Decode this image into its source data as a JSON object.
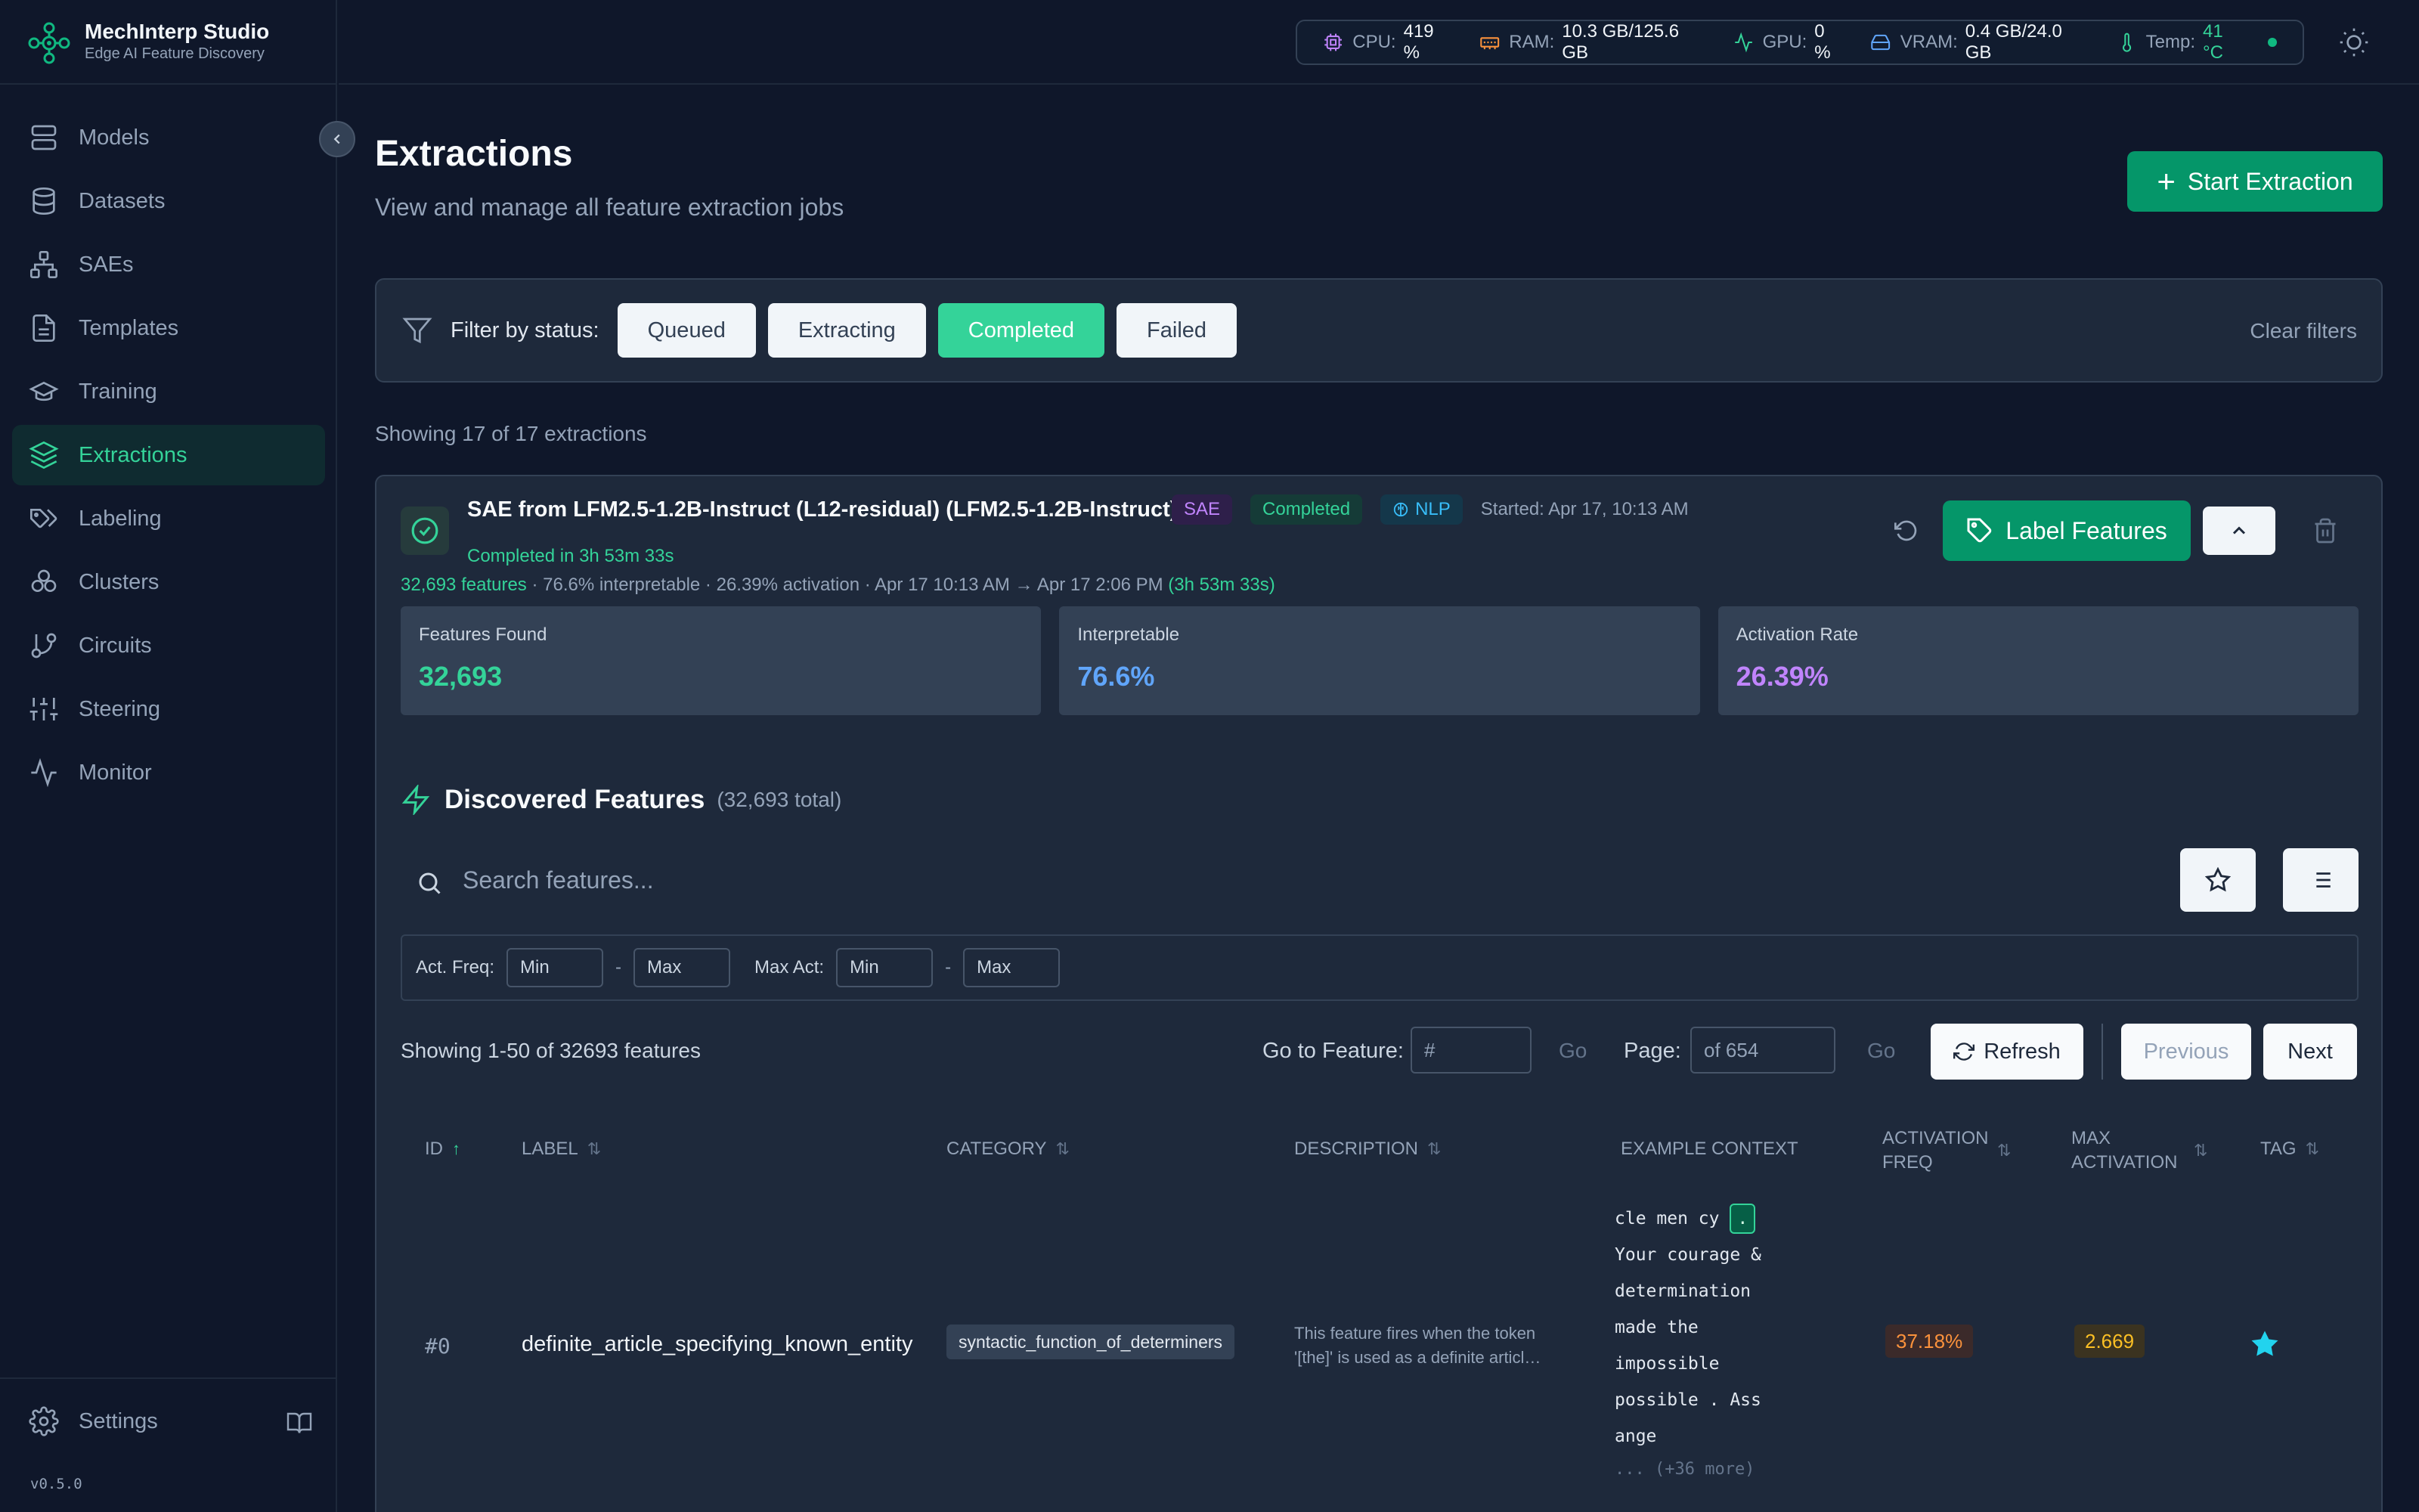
{
  "app": {
    "title": "MechInterp Studio",
    "subtitle": "Edge AI Feature Discovery",
    "version": "v0.5.0"
  },
  "sidebar": {
    "items": [
      {
        "label": "Models",
        "icon": "server-icon"
      },
      {
        "label": "Datasets",
        "icon": "database-icon"
      },
      {
        "label": "SAEs",
        "icon": "network-icon"
      },
      {
        "label": "Templates",
        "icon": "file-text-icon"
      },
      {
        "label": "Training",
        "icon": "graduation-cap-icon"
      },
      {
        "label": "Extractions",
        "icon": "layers-icon",
        "active": true
      },
      {
        "label": "Labeling",
        "icon": "tags-icon"
      },
      {
        "label": "Clusters",
        "icon": "clusters-icon"
      },
      {
        "label": "Circuits",
        "icon": "git-branch-icon"
      },
      {
        "label": "Steering",
        "icon": "sliders-icon"
      },
      {
        "label": "Monitor",
        "icon": "activity-icon"
      }
    ],
    "settings_label": "Settings"
  },
  "system": {
    "cpu_label": "CPU:",
    "cpu": "419 %",
    "ram_label": "RAM:",
    "ram": "10.3 GB/125.6 GB",
    "gpu_label": "GPU:",
    "gpu": "0 %",
    "vram_label": "VRAM:",
    "vram": "0.4 GB/24.0 GB",
    "temp_label": "Temp:",
    "temp": "41 °C",
    "colors": {
      "cpu": "#c084fc",
      "ram": "#fb923c",
      "gpu": "#34d399",
      "vram": "#60a5fa",
      "temp": "#34d399"
    }
  },
  "page": {
    "title": "Extractions",
    "subtitle": "View and manage all feature extraction jobs",
    "start_button": "Start Extraction",
    "filter_label": "Filter by status:",
    "filters": [
      "Queued",
      "Extracting",
      "Completed",
      "Failed"
    ],
    "active_filter": "Completed",
    "clear_filters": "Clear filters",
    "showing": "Showing 17 of 17 extractions"
  },
  "job": {
    "title": "SAE from LFM2.5-1.2B-Instruct (L12-residual) (LFM2.5-1.2B-Instruct)",
    "badge_type": "SAE",
    "badge_status": "Completed",
    "badge_domain": "NLP",
    "started": "Started: Apr 17, 10:13 AM",
    "completed_in": "Completed in 3h 53m 33s",
    "summary_features": "32,693 features",
    "summary_rest": " · 76.6% interpretable · 26.39% activation · Apr 17 10:13 AM → Apr 17 2:06 PM ",
    "summary_duration": "(3h 53m 33s)",
    "label_button": "Label Features",
    "metrics": [
      {
        "label": "Features Found",
        "value": "32,693",
        "color": "#34d399"
      },
      {
        "label": "Interpretable",
        "value": "76.6%",
        "color": "#60a5fa"
      },
      {
        "label": "Activation Rate",
        "value": "26.39%",
        "color": "#c084fc"
      }
    ]
  },
  "features": {
    "title": "Discovered Features",
    "count": "(32,693 total)",
    "search_placeholder": "Search features...",
    "act_freq_label": "Act. Freq:",
    "max_act_label": "Max Act:",
    "min_placeholder": "Min",
    "max_placeholder": "Max",
    "showing": "Showing 1-50 of 32693 features",
    "goto_label": "Go to Feature:",
    "goto_placeholder": "#",
    "go": "Go",
    "page_label": "Page:",
    "page_placeholder": "of 654",
    "refresh": "Refresh",
    "previous": "Previous",
    "next": "Next",
    "columns": [
      "ID",
      "LABEL",
      "CATEGORY",
      "DESCRIPTION",
      "EXAMPLE CONTEXT",
      "ACTIVATION FREQ",
      "MAX ACTIVATION",
      "TAG"
    ],
    "rows": [
      {
        "id": "#0",
        "label": "definite_article_specifying_known_entity",
        "category": "syntactic_function_of_determiners",
        "description": "This feature fires when the token '[the]' is used as a definite articl…",
        "context_before": "cle men cy ",
        "context_token": ".",
        "context_after": [
          "Your courage &",
          "determination",
          "made the",
          "impossible",
          "possible . Ass",
          "ange"
        ],
        "context_more": "... (+36 more)",
        "activation_freq": "37.18%",
        "max_activation": "2.669",
        "starred": true
      }
    ]
  }
}
